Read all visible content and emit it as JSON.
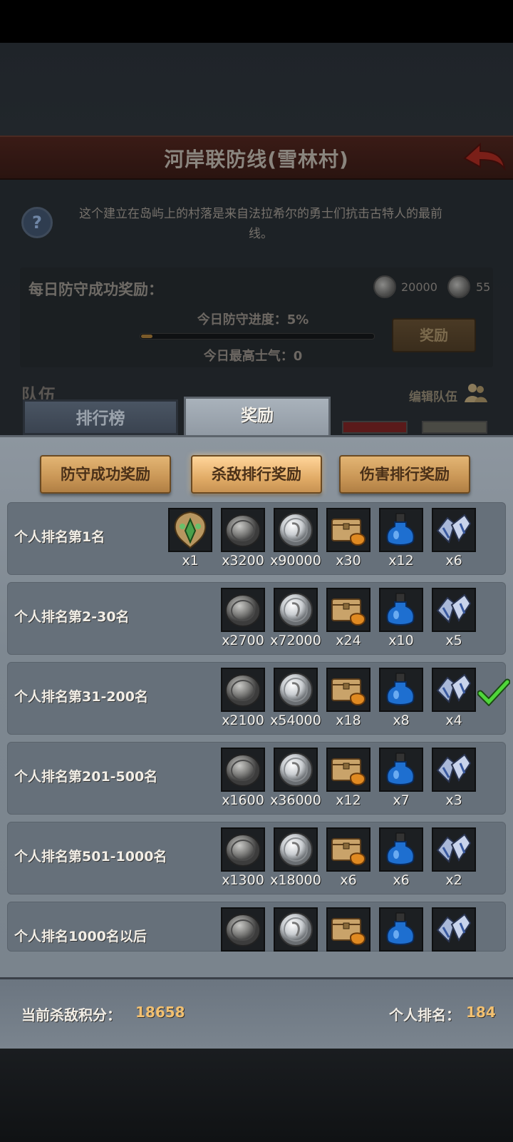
{
  "header": {
    "title": "河岸联防线(雪林村)",
    "description_line1": "这个建立在岛屿上的村落是来自法拉希尔的勇士们抗击古特人的最前",
    "description_line2": "线。"
  },
  "daily": {
    "label": "每日防守成功奖励：",
    "reward1_value": "20000",
    "reward2_value": "55",
    "progress_label": "今日防守进度：5%",
    "progress_fraction": 0.05,
    "morale_label": "今日最高士气：0",
    "reward_button": "奖励"
  },
  "team": {
    "label": "队伍",
    "edit_label": "编辑队伍"
  },
  "tabs": [
    {
      "label": "排行榜",
      "active": false
    },
    {
      "label": "奖励",
      "active": true
    }
  ],
  "sub_tabs": [
    {
      "label": "防守成功奖励",
      "active": false
    },
    {
      "label": "杀敌排行奖励",
      "active": true
    },
    {
      "label": "伤害排行奖励",
      "active": false
    }
  ],
  "rows": [
    {
      "label": "个人排名第1名",
      "items": [
        {
          "icon": "green-gem-relic-icon",
          "qty": "x1"
        },
        {
          "icon": "dark-coin-icon",
          "qty": "x3200"
        },
        {
          "icon": "silver-coin-icon",
          "qty": "x90000"
        },
        {
          "icon": "treasure-chest-icon",
          "qty": "x30"
        },
        {
          "icon": "blue-potion-icon",
          "qty": "x12"
        },
        {
          "icon": "crystal-shard-icon",
          "qty": "x6"
        }
      ]
    },
    {
      "label": "个人排名第2-30名",
      "items": [
        {
          "icon": "dark-coin-icon",
          "qty": "x2700"
        },
        {
          "icon": "silver-coin-icon",
          "qty": "x72000"
        },
        {
          "icon": "treasure-chest-icon",
          "qty": "x24"
        },
        {
          "icon": "blue-potion-icon",
          "qty": "x10"
        },
        {
          "icon": "crystal-shard-icon",
          "qty": "x5"
        }
      ]
    },
    {
      "label": "个人排名第31-200名",
      "claimed": true,
      "items": [
        {
          "icon": "dark-coin-icon",
          "qty": "x2100"
        },
        {
          "icon": "silver-coin-icon",
          "qty": "x54000"
        },
        {
          "icon": "treasure-chest-icon",
          "qty": "x18"
        },
        {
          "icon": "blue-potion-icon",
          "qty": "x8"
        },
        {
          "icon": "crystal-shard-icon",
          "qty": "x4"
        }
      ]
    },
    {
      "label": "个人排名第201-500名",
      "items": [
        {
          "icon": "dark-coin-icon",
          "qty": "x1600"
        },
        {
          "icon": "silver-coin-icon",
          "qty": "x36000"
        },
        {
          "icon": "treasure-chest-icon",
          "qty": "x12"
        },
        {
          "icon": "blue-potion-icon",
          "qty": "x7"
        },
        {
          "icon": "crystal-shard-icon",
          "qty": "x3"
        }
      ]
    },
    {
      "label": "个人排名第501-1000名",
      "items": [
        {
          "icon": "dark-coin-icon",
          "qty": "x1300"
        },
        {
          "icon": "silver-coin-icon",
          "qty": "x18000"
        },
        {
          "icon": "treasure-chest-icon",
          "qty": "x6"
        },
        {
          "icon": "blue-potion-icon",
          "qty": "x6"
        },
        {
          "icon": "crystal-shard-icon",
          "qty": "x2"
        }
      ]
    },
    {
      "label": "个人排名1000名以后",
      "items": [
        {
          "icon": "dark-coin-icon",
          "qty": ""
        },
        {
          "icon": "silver-coin-icon",
          "qty": ""
        },
        {
          "icon": "treasure-chest-icon",
          "qty": ""
        },
        {
          "icon": "blue-potion-icon",
          "qty": ""
        },
        {
          "icon": "crystal-shard-icon",
          "qty": ""
        }
      ]
    }
  ],
  "footer": {
    "score_label": "当前杀敌积分：",
    "score_value": "18658",
    "rank_label": "个人排名：",
    "rank_value": "184"
  }
}
